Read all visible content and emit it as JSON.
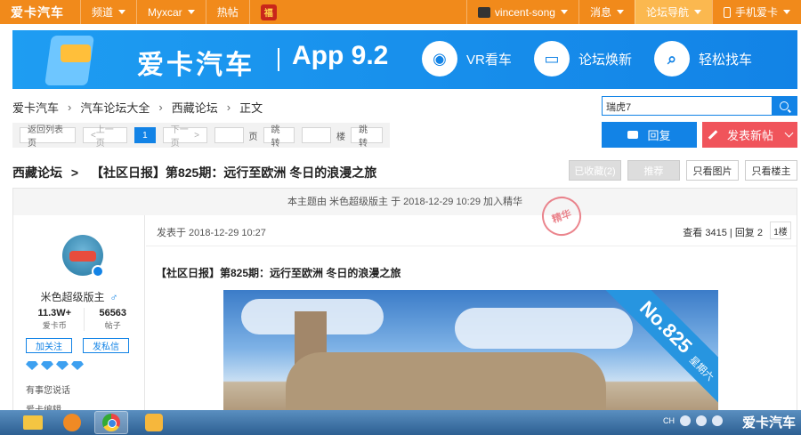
{
  "topnav": {
    "logo": "爱卡汽车",
    "items": [
      {
        "label": "频道",
        "caret": true
      },
      {
        "label": "Myxcar",
        "caret": true
      },
      {
        "label": "热帖",
        "caret": false
      }
    ],
    "festival_badge": "福",
    "username": "vincent-song",
    "messages": "消息",
    "forum_nav": "论坛导航",
    "mobile": "手机爱卡",
    "accent_color": "#f18a1b"
  },
  "banner": {
    "brand": "爱卡汽车",
    "version": "App 9.2",
    "features": [
      {
        "label": "VR看车",
        "icon": "vr-icon"
      },
      {
        "label": "论坛焕新",
        "icon": "monitor-icon"
      },
      {
        "label": "轻松找车",
        "icon": "search-car-icon"
      }
    ]
  },
  "breadcrumb": [
    "爱卡汽车",
    "汽车论坛大全",
    "西藏论坛",
    "正文"
  ],
  "search": {
    "value": "瑞虎7"
  },
  "pager": {
    "back": "返回列表页",
    "prev": "上一页",
    "current": "1",
    "next": "下一页",
    "page_label": "页",
    "jump": "跳转",
    "floor_label": "楼",
    "jump2": "跳转"
  },
  "actions": {
    "reply": "回复",
    "new_post": "发表新帖"
  },
  "thread": {
    "forum": "西藏论坛",
    "arrow": ">",
    "title": "【社区日报】第825期：远行至欧洲 冬日的浪漫之旅",
    "collected": "已收藏(2)",
    "recommend": "推荐",
    "only_images": "只看图片",
    "only_op": "只看楼主"
  },
  "notice": "本主题由 米色超级版主 于 2018-12-29 10:29 加入精华",
  "author": {
    "name": "米色超级版主",
    "gender_symbol": "♂",
    "coins": "11.3W+",
    "coins_label": "爱卡币",
    "posts": "56563",
    "posts_label": "帖子",
    "follow": "加关注",
    "message": "发私信",
    "diamond_count": 4,
    "motto": "有事您说话",
    "edit": "爱卡编辑"
  },
  "post": {
    "time": "发表于 2018-12-29 10:27",
    "views_label": "查看",
    "views": "3415",
    "sep": "|",
    "replies_label": "回复",
    "replies": "2",
    "floor": "1楼",
    "stamp": "精华",
    "body_title": "【社区日报】第825期：远行至欧洲 冬日的浪漫之旅",
    "image_ribbon": "No.825",
    "image_weekday": "星期六"
  },
  "taskbar": {
    "lang": "CH",
    "watermark": "爱卡汽车"
  }
}
